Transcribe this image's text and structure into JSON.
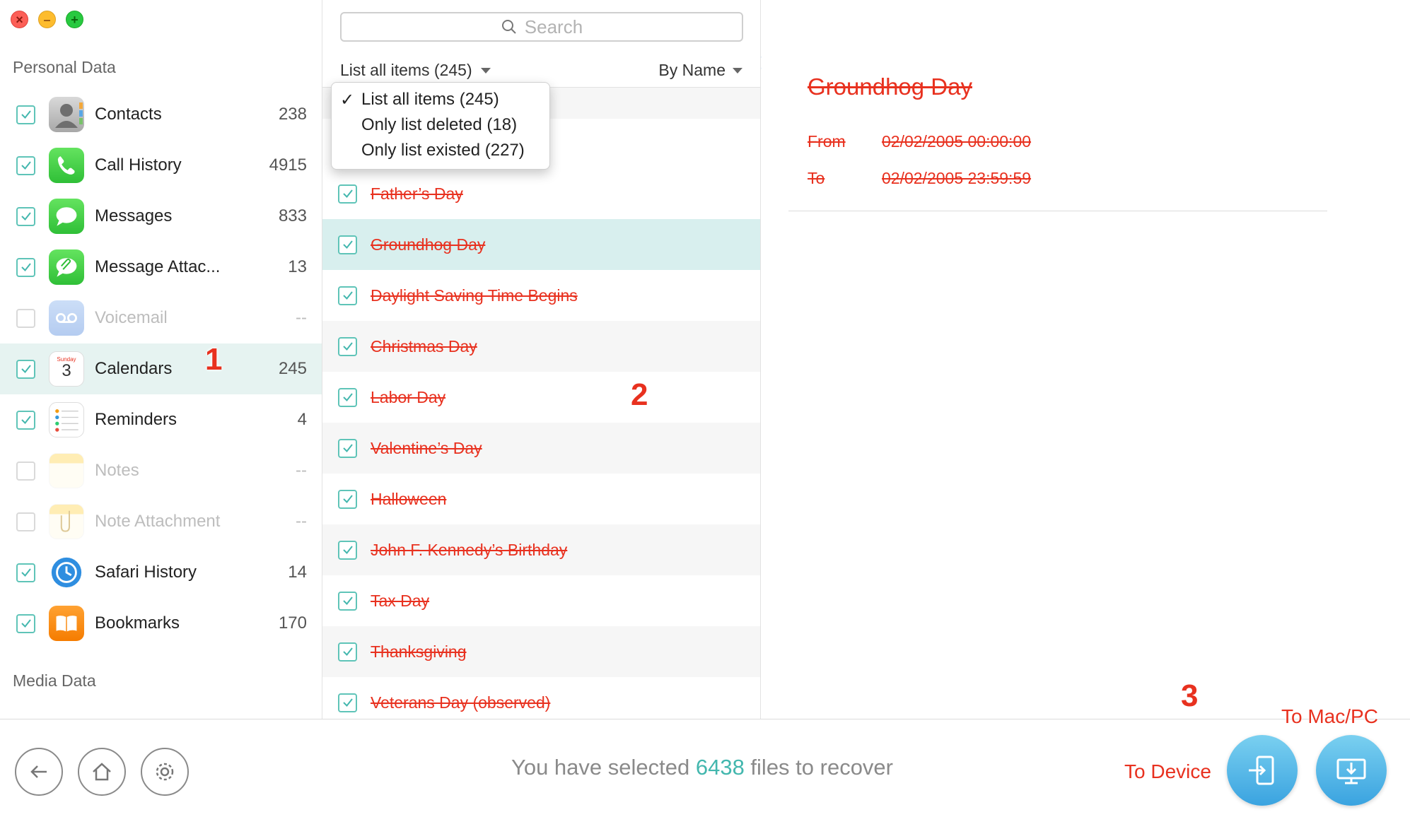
{
  "window": {
    "buttons": [
      "close",
      "minimize",
      "maximize"
    ]
  },
  "sidebar": {
    "personal_title": "Personal Data",
    "media_title": "Media Data",
    "items": [
      {
        "label": "Contacts",
        "count": "238",
        "checked": true,
        "enabled": true,
        "icon": "contacts-icon"
      },
      {
        "label": "Call History",
        "count": "4915",
        "checked": true,
        "enabled": true,
        "icon": "phone-icon"
      },
      {
        "label": "Messages",
        "count": "833",
        "checked": true,
        "enabled": true,
        "icon": "messages-icon"
      },
      {
        "label": "Message Attac...",
        "count": "13",
        "checked": true,
        "enabled": true,
        "icon": "attachment-icon"
      },
      {
        "label": "Voicemail",
        "count": "--",
        "checked": false,
        "enabled": false,
        "icon": "voicemail-icon"
      },
      {
        "label": "Calendars",
        "count": "245",
        "checked": true,
        "enabled": true,
        "icon": "calendar-icon",
        "active": true
      },
      {
        "label": "Reminders",
        "count": "4",
        "checked": true,
        "enabled": true,
        "icon": "reminders-icon"
      },
      {
        "label": "Notes",
        "count": "--",
        "checked": false,
        "enabled": false,
        "icon": "notes-icon"
      },
      {
        "label": "Note Attachment",
        "count": "--",
        "checked": false,
        "enabled": false,
        "icon": "note-attachment-icon"
      },
      {
        "label": "Safari History",
        "count": "14",
        "checked": true,
        "enabled": true,
        "icon": "safari-history-icon"
      },
      {
        "label": "Bookmarks",
        "count": "170",
        "checked": true,
        "enabled": true,
        "icon": "bookmarks-icon"
      }
    ],
    "calendar_icon": {
      "weekday": "Sunday",
      "day": "3"
    }
  },
  "list": {
    "search_placeholder": "Search",
    "filter_label": "List all items (245)",
    "sort_label": "By Name",
    "dropdown": {
      "check": "✓",
      "options": [
        "List all items (245)",
        "Only list deleted (18)",
        "Only list existed (227)"
      ],
      "selected_index": 0
    },
    "events": [
      "Father’s Day",
      "Groundhog Day",
      "Daylight Saving Time Begins",
      "Christmas Day",
      "Labor Day",
      "Valentine’s Day",
      "Halloween",
      "John F. Kennedy’s Birthday",
      "Tax Day",
      "Thanksgiving",
      "Veterans Day (observed)"
    ],
    "selected_event_index": 1
  },
  "detail": {
    "title": "Groundhog Day",
    "from_label": "From",
    "from_value": "02/02/2005 00:00:00",
    "to_label": "To",
    "to_value": "02/02/2005 23:59:59"
  },
  "bottom": {
    "status_prefix": "You have selected ",
    "status_count": "6438",
    "status_suffix": " files to recover",
    "to_device_label": "To Device",
    "to_mac_label": "To Mac/PC"
  },
  "annotations": {
    "step1": "1",
    "step2": "2",
    "step3": "3"
  },
  "colors": {
    "accent": "#43b7ae",
    "deleted_text": "#e8311f",
    "active_row": "#e6f3f1",
    "selected_row": "#d8efee",
    "action_button": "#3aa3e0"
  }
}
